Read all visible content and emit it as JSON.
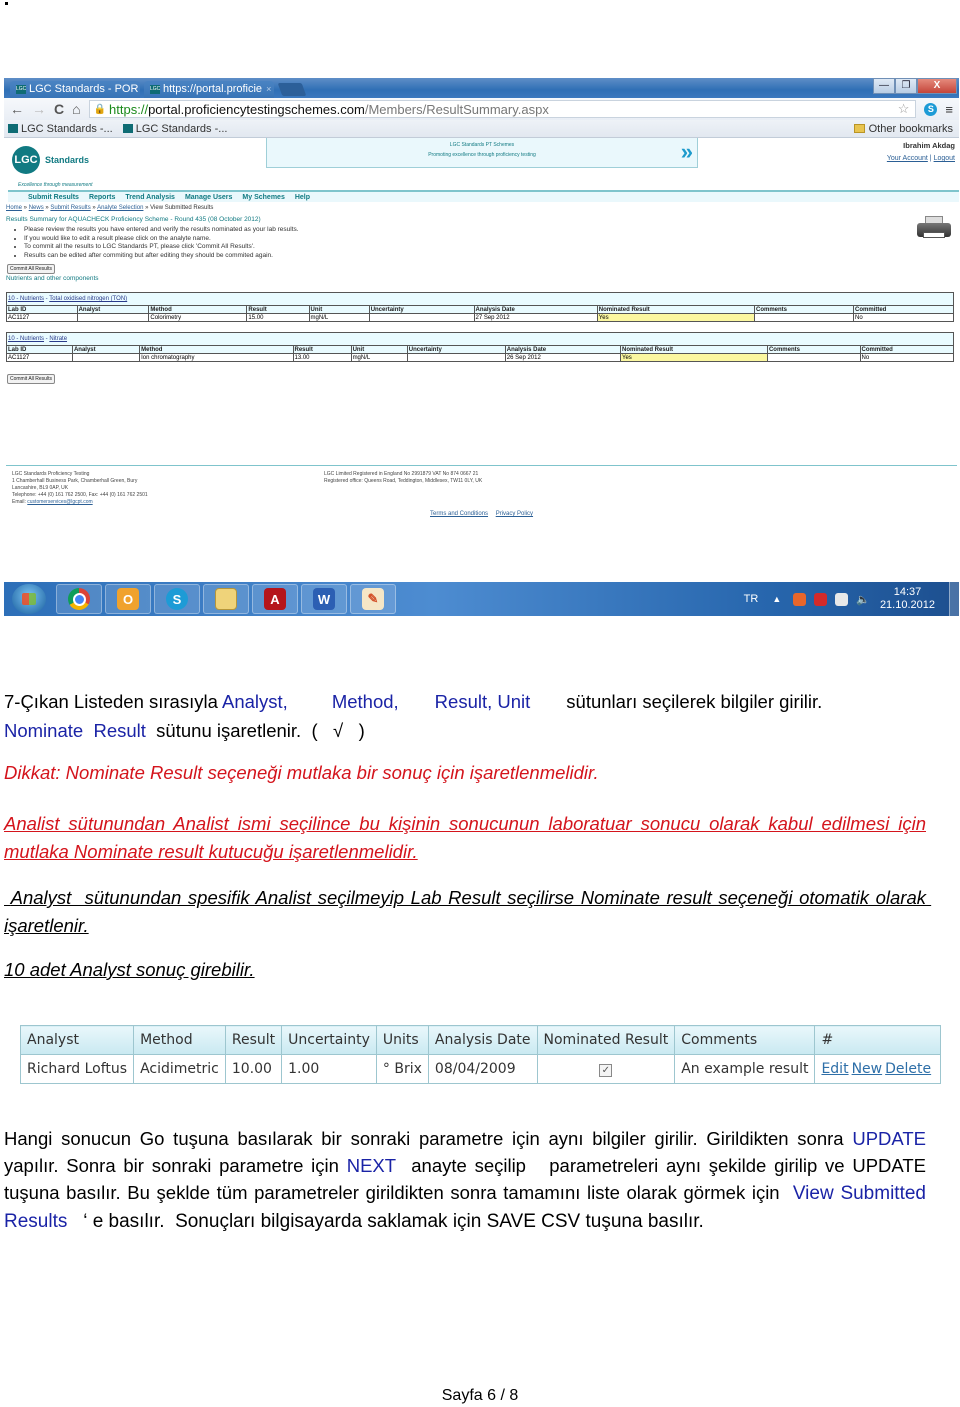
{
  "browser": {
    "tabs": [
      {
        "label": "LGC Standards - POR",
        "favicon": "LGC"
      },
      {
        "label": "https://portal.proficie",
        "favicon": "LGC"
      }
    ],
    "url": {
      "protocol": "https://",
      "host": "portal.proficiencytestingschemes.com",
      "path": "/Members/ResultSummary.aspx"
    },
    "bookmarks": [
      "LGC Standards -...",
      "LGC Standards -..."
    ],
    "other_bookmarks": "Other bookmarks",
    "window_buttons": {
      "minimize": "—",
      "maximize": "❐",
      "close": "X"
    }
  },
  "site": {
    "logo_text": "LGC",
    "logo_name": "Standards",
    "tagline": "Excellence through measurement",
    "banner_line1": "LGC Standards PT Schemes",
    "banner_line2": "Promoting excellence through proficiency testing",
    "user_name": "Ibrahim Akdag",
    "your_account": "Your Account",
    "separator": " | ",
    "logout": "Logout",
    "nav": [
      "Submit Results",
      "Reports",
      "Trend Analysis",
      "Manage Users",
      "My Schemes",
      "Help"
    ],
    "breadcrumb": [
      {
        "label": "Home",
        "link": true
      },
      {
        "label": "News",
        "link": true
      },
      {
        "label": "Submit Results",
        "link": true
      },
      {
        "label": "Analyte Selection",
        "link": true
      },
      {
        "label": "View Submitted Results",
        "link": false
      }
    ],
    "results_title": "Results Summary for AQUACHECK Proficiency Scheme - Round 435 (08 October 2012)",
    "instructions": [
      "Please review the results you have entered and verify the results nominated as your lab results.",
      "If you would like to edit a result please click on the analyte name.",
      "To commit all the results to LGC Standards PT, please click 'Commit All Results'.",
      "Results can be edited after commiting but after editing they should be commited again."
    ],
    "commit_button": "Commit All Results",
    "group_title": "Nutrients and other components",
    "result_tables": [
      {
        "group_link": "10 - Nutrients",
        "analyte_link": "Total oxidised nitrogen (TON)",
        "columns": [
          "Lab ID",
          "Analyst",
          "Method",
          "Result",
          "Unit",
          "Uncertainty",
          "Analysis Date",
          "Nominated Result",
          "Comments",
          "Committed"
        ],
        "row": [
          "AC1127",
          "",
          "Colorimetry",
          "15.00",
          "mgN/L",
          "",
          "27 Sep 2012",
          "Yes",
          "",
          "No"
        ]
      },
      {
        "group_link": "10 - Nutrients",
        "analyte_link": "Nitrate",
        "columns": [
          "Lab ID",
          "Analyst",
          "Method",
          "Result",
          "Unit",
          "Uncertainty",
          "Analysis Date",
          "Nominated Result",
          "Comments",
          "Committed"
        ],
        "row": [
          "AC1127",
          "",
          "Ion chromatography",
          "13.00",
          "mgN/L",
          "",
          "26 Sep 2012",
          "Yes",
          "",
          "No"
        ]
      }
    ],
    "footer_left": [
      "LGC Standards Proficiency Testing",
      "1 Chamberhall Business Park, Chamberhall Green, Bury",
      "Lancashire, BL9 0AP, UK",
      "Telephone: +44 (0) 161 762 2500, Fax: +44 (0) 161 762 2501"
    ],
    "footer_email_label": "Email: ",
    "footer_email": "customerservices@lgcpt.com",
    "footer_right": [
      "LGC Limited Registered in England No 2991879 VAT No 874 0667 21",
      "Registered office: Queens Road, Teddington, Middlesex, TW11 0LY, UK"
    ],
    "terms": "Terms and Conditions",
    "privacy": "Privacy Policy"
  },
  "taskbar": {
    "apps": [
      "start",
      "chrome",
      "outlook",
      "skype",
      "explorer",
      "acrobat",
      "word",
      "paint"
    ],
    "language": "TR",
    "time": "14:37",
    "date": "21.10.2012"
  },
  "doc": {
    "p1_a": "7-Çıkan Listeden sırasıyla ",
    "p1_analyst": "Analyst,",
    "p1_method": "Method,",
    "p1_result_unit": "Result, Unit",
    "p1_b": "sütunları seçilerek bilgiler girilir.",
    "p1_nominate": "Nominate  Result",
    "p1_c": "  sütunu işaretlenir.  (   √   )",
    "dikkat": "Dikkat:  Nominate Result seçeneği mutlaka bir sonuç için işaretlenmelidir.",
    "analist": "Analist sütunundan Analist ismi seçilince  bu  kişinin  sonucunun laboratuar sonucu olarak kabul edilmesi için mutlaka Nominate result kutucuğu işaretlenmelidir.",
    "analyst": " Analyst  sütunundan spesifik Analist seçilmeyip Lab Result seçilirse Nominate result seçeneği otomatik olarak işaretlenir.",
    "ten": "10 adet Analyst sonuç girebilir.",
    "last_a": "Hangi sonucun Go tuşuna basılarak bir sonraki parametre için aynı bilgiler girilir.  Girildikten sonra ",
    "last_update": "UPDATE",
    "last_b": " yapılır.  Sonra bir sonraki parametre için ",
    "last_next": "NEXT",
    "last_c": "  anayte seçilip   parametreleri aynı şekilde girilip ve UPDATE tuşuna basılır. Bu şeklde tüm parametreler girildikten sonra tamamını liste olarak görmek için  ",
    "last_view": "View Submitted Results",
    "last_d": "   ‘ e basılır.  Sonuçları bilgisayarda saklamak için SAVE CSV tuşuna basılır.",
    "page": "Sayfa 6 / 8"
  },
  "sample_table": {
    "columns": [
      "Analyst",
      "Method",
      "Result",
      "Uncertainty",
      "Units",
      "Analysis Date",
      "Nominated Result",
      "Comments",
      "#"
    ],
    "row": {
      "analyst": "Richard Loftus",
      "method": "Acidimetric",
      "result": "10.00",
      "uncertainty": "1.00",
      "units": "° Brix",
      "date": "08/04/2009",
      "nominated": true,
      "nominated_glyph": "✓",
      "comments": "An example result",
      "actions": [
        "Edit",
        "New",
        "Delete"
      ]
    }
  }
}
